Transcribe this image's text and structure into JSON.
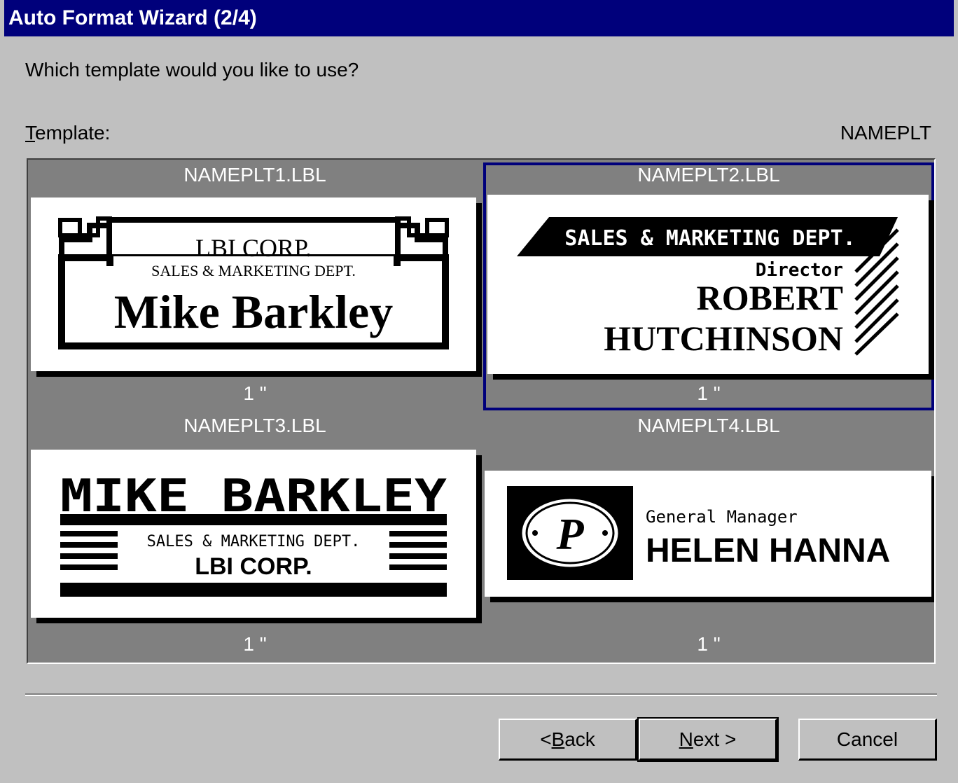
{
  "window": {
    "title": "Auto Format Wizard (2/4)"
  },
  "prompt": "Which template would you like to use?",
  "template_field": {
    "label_prefix": "T",
    "label_rest": "emplate:",
    "current_value": "NAMEPLT"
  },
  "templates": [
    {
      "file": "NAMEPLT1.LBL",
      "size": "1 \"",
      "lines": [
        "LBI CORP.",
        "SALES & MARKETING DEPT.",
        "Mike Barkley"
      ],
      "selected": false
    },
    {
      "file": "NAMEPLT2.LBL",
      "size": "1 \"",
      "lines": [
        "SALES & MARKETING DEPT.",
        "Director",
        "ROBERT",
        "HUTCHINSON"
      ],
      "selected": true
    },
    {
      "file": "NAMEPLT3.LBL",
      "size": "1 \"",
      "lines": [
        "MIKE BARKLEY",
        "SALES & MARKETING DEPT.",
        "LBI CORP."
      ],
      "selected": false
    },
    {
      "file": "NAMEPLT4.LBL",
      "size": "1 \"",
      "lines": [
        "General Manager",
        "HELEN HANNA"
      ],
      "logo_letter": "P",
      "selected": false
    }
  ],
  "buttons": {
    "back": {
      "pre": "< ",
      "key": "B",
      "rest": "ack"
    },
    "next": {
      "key": "N",
      "rest": "ext >"
    },
    "cancel": "Cancel"
  },
  "colors": {
    "title_bar": "#00007b",
    "dialog_bg": "#c0c0c0",
    "gallery_bg": "#808080",
    "selection": "#00007b"
  }
}
